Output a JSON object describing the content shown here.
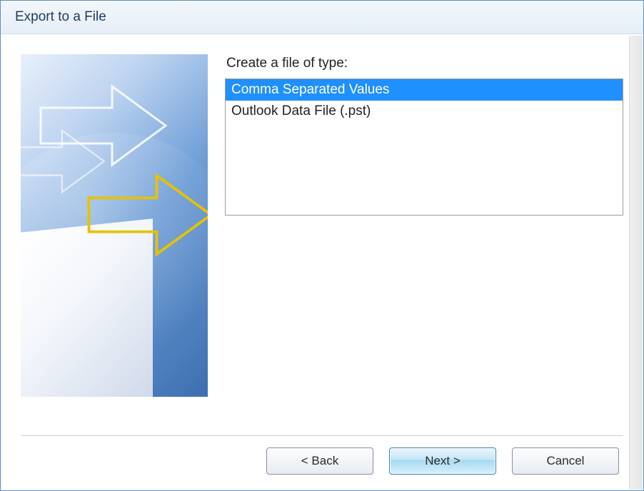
{
  "title": "Export to a File",
  "prompt": "Create a file of type:",
  "file_types": [
    {
      "label": "Comma Separated Values",
      "selected": true
    },
    {
      "label": "Outlook Data File (.pst)",
      "selected": false
    }
  ],
  "buttons": {
    "back": "< Back",
    "next": "Next >",
    "cancel": "Cancel"
  }
}
